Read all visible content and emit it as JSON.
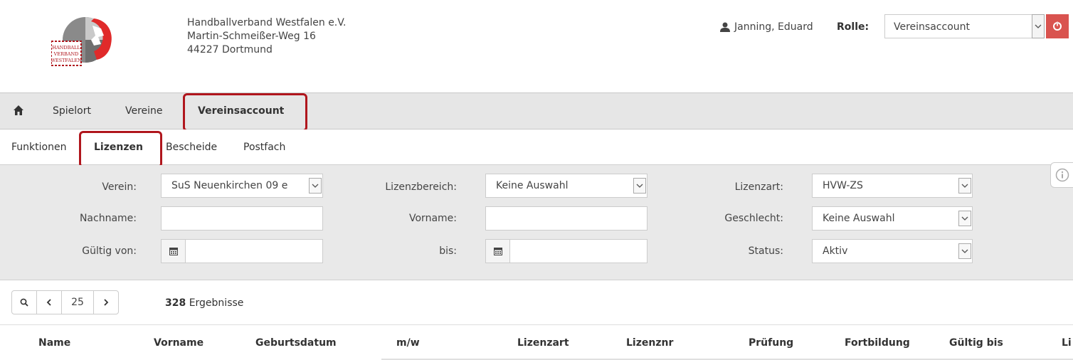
{
  "header": {
    "logo_text": [
      "HANDBALL",
      "VERBAND",
      "WESTFALEN"
    ],
    "org_lines": [
      "Handballverband Westfalen e.V.",
      "Martin-Schmeißer-Weg 16",
      "44227 Dortmund"
    ],
    "user_name": "Janning, Eduard",
    "rolle_label": "Rolle:",
    "rolle_value": "Vereinsaccount"
  },
  "mainnav": {
    "items": [
      {
        "label": "Spielort"
      },
      {
        "label": "Vereine"
      },
      {
        "label": "Vereinsaccount"
      }
    ]
  },
  "subnav": {
    "items": [
      {
        "label": "Funktionen"
      },
      {
        "label": "Lizenzen"
      },
      {
        "label": "Bescheide"
      },
      {
        "label": "Postfach"
      }
    ]
  },
  "filter": {
    "verein_label": "Verein:",
    "verein_value": "SuS Neuenkirchen 09 e",
    "lizenzbereich_label": "Lizenzbereich:",
    "lizenzbereich_value": "Keine Auswahl",
    "lizenzart_label": "Lizenzart:",
    "lizenzart_value": "HVW-ZS",
    "nachname_label": "Nachname:",
    "nachname_value": "",
    "vorname_label": "Vorname:",
    "vorname_value": "",
    "geschlecht_label": "Geschlecht:",
    "geschlecht_value": "Keine Auswahl",
    "gueltig_von_label": "Gültig von:",
    "gueltig_von_value": "",
    "bis_label": "bis:",
    "bis_value": "",
    "status_label": "Status:",
    "status_value": "Aktiv"
  },
  "pager": {
    "page_size": "25",
    "result_count": "328",
    "result_label": "Ergebnisse"
  },
  "table": {
    "headers": [
      "Name",
      "Vorname",
      "Geburtsdatum",
      "m/w",
      "Lizenzart",
      "Lizenznr",
      "Prüfung",
      "Fortbildung",
      "Gültig bis",
      "Li"
    ]
  },
  "colors": {
    "highlight": "#b0161d",
    "logout": "#d9534f",
    "nav_bg": "#e6e6e6",
    "filter_bg": "#e9e9e9"
  }
}
